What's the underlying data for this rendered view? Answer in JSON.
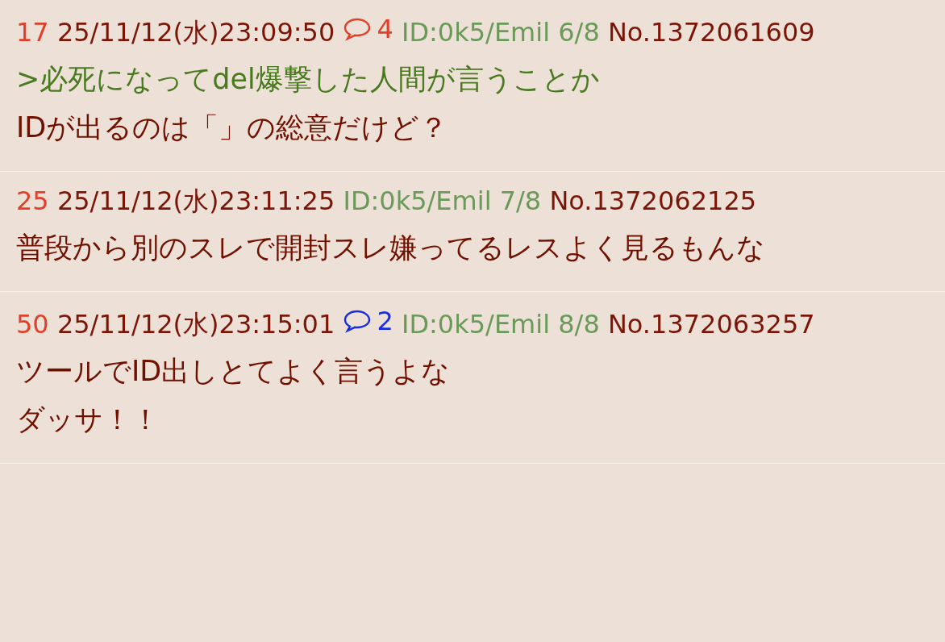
{
  "posts": [
    {
      "number": "17",
      "date": "25/11/12(水)23:09:50",
      "replies": {
        "count": "4",
        "color": "#e0402a"
      },
      "poster_id": "ID:0k5/Emil 6/8",
      "post_no": "No.1372061609",
      "lines": [
        {
          "kind": "quote",
          "text": ">必死になってdel爆撃した人間が言うことか"
        },
        {
          "kind": "text",
          "text": "IDが出るのは「」の総意だけど？"
        }
      ]
    },
    {
      "number": "25",
      "date": "25/11/12(水)23:11:25",
      "poster_id": "ID:0k5/Emil 7/8",
      "post_no": "No.1372062125",
      "lines": [
        {
          "kind": "text",
          "text": "普段から別のスレで開封スレ嫌ってるレスよく見るもんな"
        }
      ]
    },
    {
      "number": "50",
      "date": "25/11/12(水)23:15:01",
      "replies": {
        "count": "2",
        "color": "#1a2ee0"
      },
      "poster_id": "ID:0k5/Emil 8/8",
      "post_no": "No.1372063257",
      "lines": [
        {
          "kind": "text",
          "text": "ツールでID出しとてよく言うよな"
        },
        {
          "kind": "text",
          "text": "ダッサ！！"
        }
      ]
    }
  ]
}
